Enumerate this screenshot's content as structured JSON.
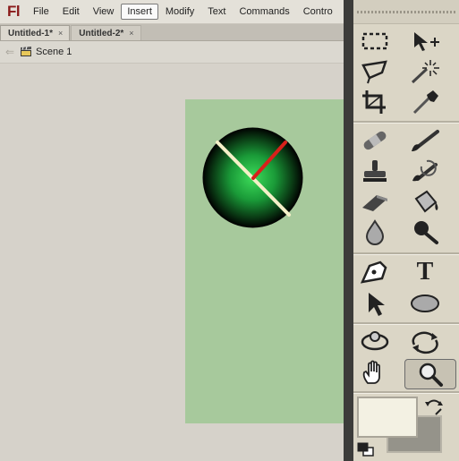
{
  "app": {
    "logo": "Fl"
  },
  "menu": {
    "items": [
      {
        "label": "File"
      },
      {
        "label": "Edit"
      },
      {
        "label": "View"
      },
      {
        "label": "Insert"
      },
      {
        "label": "Modify"
      },
      {
        "label": "Text"
      },
      {
        "label": "Commands"
      },
      {
        "label": "Contro"
      }
    ],
    "active": "Insert"
  },
  "tabs": [
    {
      "label": "Untitled-1*",
      "close": "×"
    },
    {
      "label": "Untitled-2*",
      "close": "×"
    }
  ],
  "editbar": {
    "back": "⇐",
    "scene_label": "Scene 1"
  },
  "colors": {
    "stage": "#a7c99c",
    "clock_center": "#3ddc5a",
    "clock_edge": "#000000",
    "long_hand": "#f5f0c8",
    "short_hand": "#d8201a",
    "stroke_color": "#f3f1e3",
    "fill_color": "#95938a"
  },
  "tools": [
    "marquee-icon",
    "free-transform-icon",
    "lasso-icon",
    "magic-wand-icon",
    "crop-icon",
    "eyedropper-icon",
    "bandage-icon",
    "brush-icon",
    "stamp-icon",
    "pattern-brush-icon",
    "eraser-icon",
    "paint-bucket-icon",
    "blur-drop-icon",
    "dodge-icon",
    "pen-icon",
    "text-tool-icon",
    "selection-arrow-icon",
    "ellipse-icon",
    "rotate-3d-icon",
    "refresh-icon",
    "hand-icon",
    "zoom-icon"
  ],
  "text_tool_glyph": "T"
}
